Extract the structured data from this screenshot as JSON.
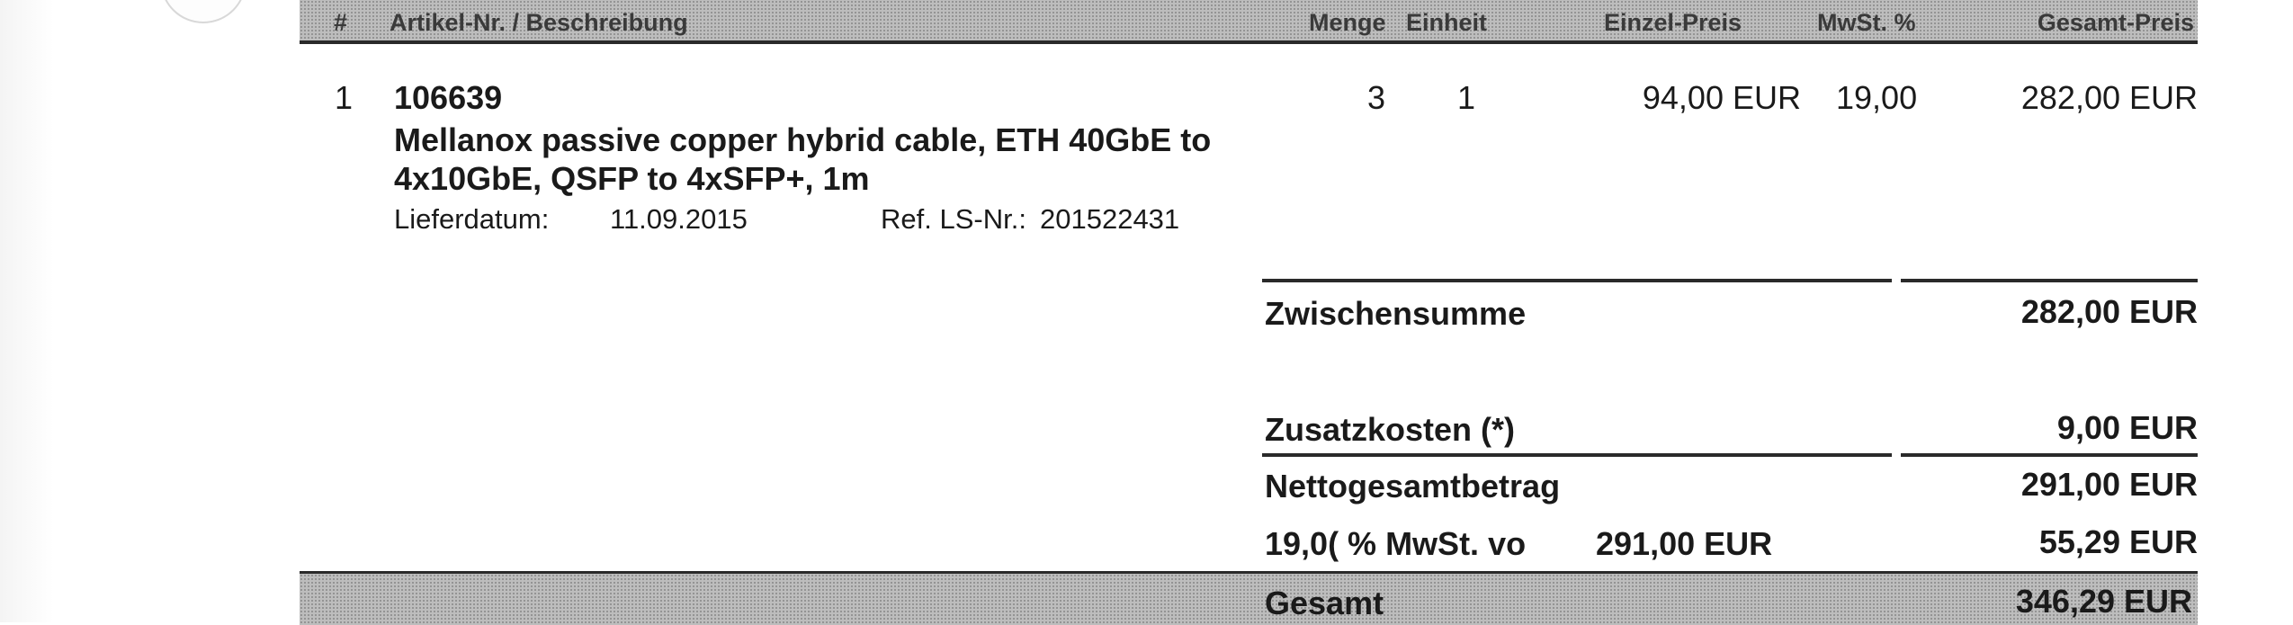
{
  "table_header": {
    "col_num": "#",
    "col_article": "Artikel-Nr. / Beschreibung",
    "col_qty": "Menge",
    "col_unit": "Einheit",
    "col_unit_price": "Einzel-Preis",
    "col_vat": "MwSt. %",
    "col_total_price": "Gesamt-Preis"
  },
  "line_items": [
    {
      "pos": "1",
      "article_no": "106639",
      "description_line1": "Mellanox passive copper hybrid cable, ETH 40GbE to",
      "description_line2": "4x10GbE, QSFP to 4xSFP+, 1m",
      "delivery_label": "Lieferdatum:",
      "delivery_date": "11.09.2015",
      "ref_label": "Ref. LS-Nr.:",
      "ref_value": "201522431",
      "qty": "3",
      "unit": "1",
      "unit_price": "94,00 EUR",
      "vat": "19,00",
      "total_price": "282,00 EUR"
    }
  ],
  "summary": {
    "subtotal_label": "Zwischensumme",
    "subtotal_value": "282,00 EUR",
    "extra_label": "Zusatzkosten (*)",
    "extra_value": "9,00 EUR",
    "net_label": "Nettogesamtbetrag",
    "net_value": "291,00 EUR",
    "vat_label": "19,0( % MwSt. vo",
    "vat_base": "291,00 EUR",
    "vat_value": "55,29 EUR",
    "grand_label": "Gesamt",
    "grand_value": "346,29 EUR"
  }
}
